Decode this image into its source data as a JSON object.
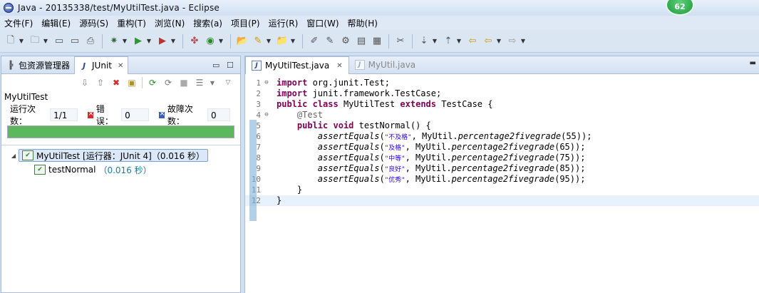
{
  "window": {
    "title": "Java  -  20135338/test/MyUtilTest.java  -  Eclipse",
    "badge": "62"
  },
  "menu": [
    "文件(F)",
    "编辑(E)",
    "源码(S)",
    "重构(T)",
    "浏览(N)",
    "搜索(a)",
    "项目(P)",
    "运行(R)",
    "窗口(W)",
    "帮助(H)"
  ],
  "left_view": {
    "tabs": [
      {
        "label": "包资源管理器",
        "icon": "package-explorer-icon",
        "active": false
      },
      {
        "label": "JUnit",
        "icon": "junit-icon",
        "active": true
      }
    ],
    "test_class": "MyUtilTest",
    "counters": {
      "runs_label": "运行次数：",
      "runs_value": "1/1",
      "errors_label": "错误：",
      "errors_value": "0",
      "failures_label": "故障次数：",
      "failures_value": "0"
    },
    "progress": 1.0,
    "progress_color": "#5cb85c",
    "tree": {
      "root_label": "MyUtilTest [运行器：JUnit 4]（0.016 秒）",
      "child_name": "testNormal",
      "child_time": "（0.016 秒）"
    }
  },
  "editor": {
    "tabs": [
      {
        "label": "MyUtilTest.java",
        "active": true
      },
      {
        "label": "MyUtil.java",
        "active": false
      }
    ],
    "line_numbers": [
      "1",
      "2",
      "3",
      "4",
      "5",
      "6",
      "7",
      "8",
      "9",
      "10",
      "11",
      "12"
    ],
    "lines": [
      {
        "kw": "import",
        "rest": " org.junit.Test;"
      },
      {
        "kw": "import",
        "rest": " junit.framework.TestCase;"
      },
      {
        "kw1": "public",
        "kw2": "class",
        "name": " MyUtilTest ",
        "kw3": "extends",
        "rest": " TestCase {"
      },
      {
        "ann": "@Test"
      },
      {
        "kw1": "public",
        "kw2": "void",
        "rest": " testNormal() {"
      },
      {
        "call": "assertEquals",
        "str": "\"不及格\"",
        "mid": ", MyUtil.",
        "method": "percentage2fivegrade",
        "end": "(55));"
      },
      {
        "call": "assertEquals",
        "str": "\"及格\"",
        "mid": ", MyUtil.",
        "method": "percentage2fivegrade",
        "end": "(65));"
      },
      {
        "call": "assertEquals",
        "str": "\"中等\"",
        "mid": ", MyUtil.",
        "method": "percentage2fivegrade",
        "end": "(75));"
      },
      {
        "call": "assertEquals",
        "str": "\"良好\"",
        "mid": ", MyUtil.",
        "method": "percentage2fivegrade",
        "end": "(85));"
      },
      {
        "call": "assertEquals",
        "str": "\"优秀\"",
        "mid": ", MyUtil.",
        "method": "percentage2fivegrade",
        "end": "(95));"
      },
      {
        "rest": "}"
      },
      {
        "rest": "}"
      }
    ]
  }
}
